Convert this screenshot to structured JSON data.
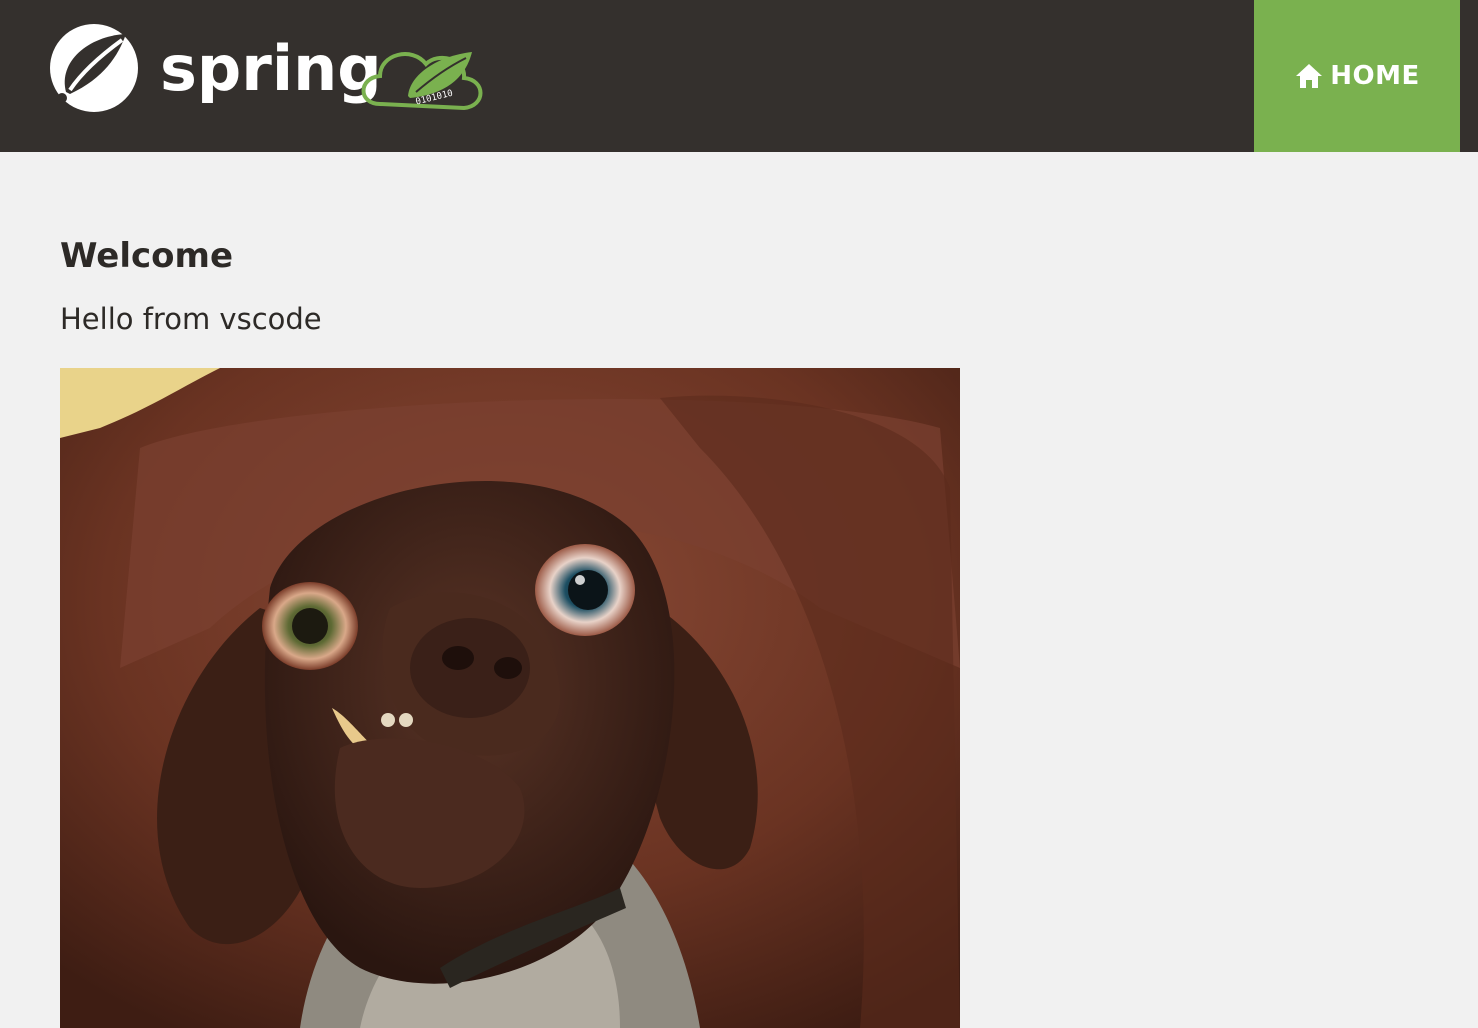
{
  "header": {
    "brand_text": "spring",
    "brand_cloud_digits": "0101010",
    "nav": {
      "home_label": "HOME",
      "home_icon": "home-icon"
    },
    "colors": {
      "navbar_bg": "#34302d",
      "accent": "#7ab14f"
    }
  },
  "main": {
    "heading": "Welcome",
    "message": "Hello from vscode",
    "image": {
      "description": "photo of a brown dog"
    }
  }
}
